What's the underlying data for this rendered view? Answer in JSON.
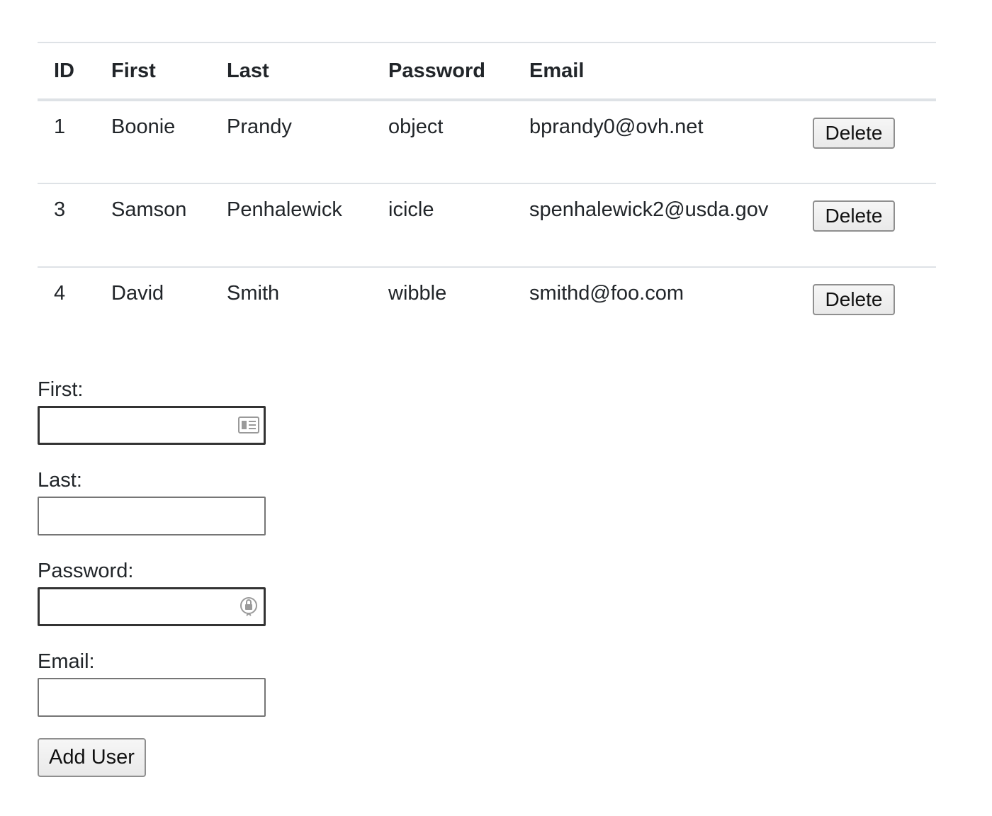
{
  "table": {
    "headers": {
      "id": "ID",
      "first": "First",
      "last": "Last",
      "password": "Password",
      "email": "Email"
    },
    "rows": [
      {
        "id": "1",
        "first": "Boonie",
        "last": "Prandy",
        "password": "object",
        "email": "bprandy0@ovh.net",
        "delete_label": "Delete"
      },
      {
        "id": "3",
        "first": "Samson",
        "last": "Penhalewick",
        "password": "icicle",
        "email": "spenhalewick2@usda.gov",
        "delete_label": "Delete"
      },
      {
        "id": "4",
        "first": "David",
        "last": "Smith",
        "password": "wibble",
        "email": "smithd@foo.com",
        "delete_label": "Delete"
      }
    ]
  },
  "form": {
    "first": {
      "label": "First:",
      "value": "",
      "icon": "contact-card-icon"
    },
    "last": {
      "label": "Last:",
      "value": ""
    },
    "password": {
      "label": "Password:",
      "value": "",
      "icon": "password-key-icon"
    },
    "email": {
      "label": "Email:",
      "value": ""
    },
    "submit_label": "Add User"
  }
}
